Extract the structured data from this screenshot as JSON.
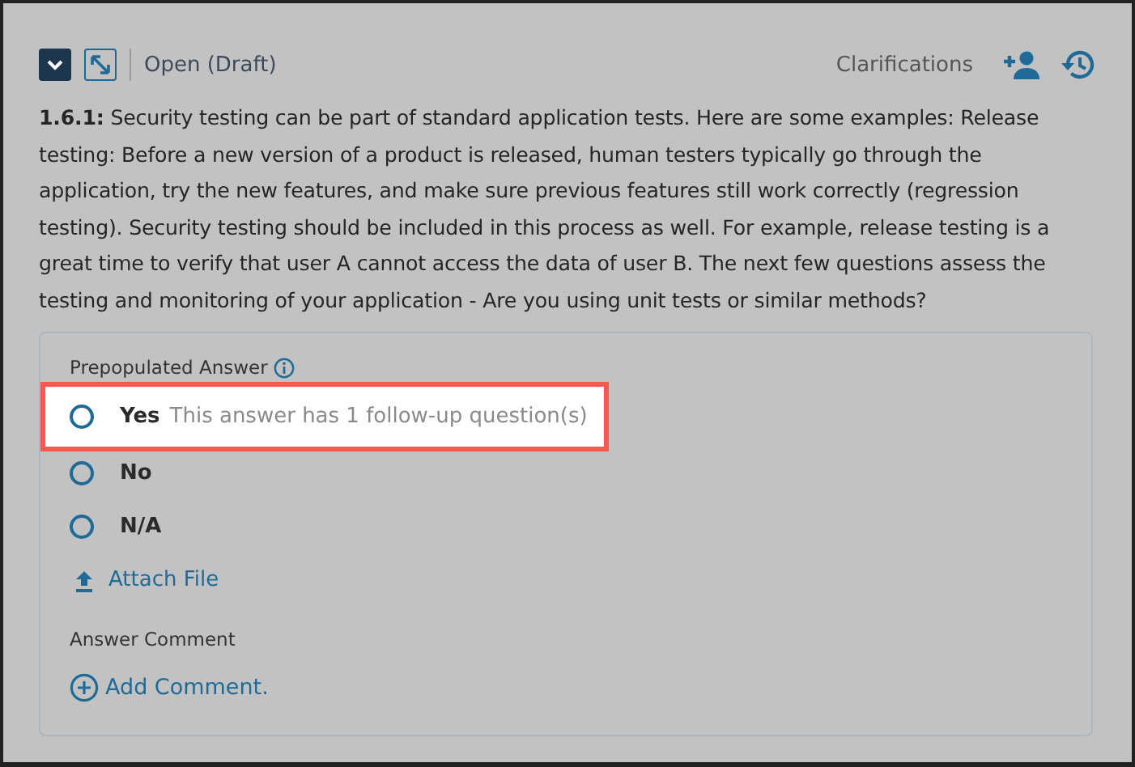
{
  "header": {
    "status": "Open (Draft)",
    "clarifications_label": "Clarifications"
  },
  "question": {
    "number": "1.6.1:",
    "text": "Security testing can be part of standard application tests. Here are some examples: Release testing: Before a new version of a product is released, human testers typically go through the application, try the new features, and make sure previous features still work correctly (regression testing). Security testing should be included in this process as well. For example, release testing is a great time to verify that user A cannot access the data of user B. The next few questions assess the testing and monitoring of your application - Are you using unit tests or similar methods?"
  },
  "answer": {
    "label": "Prepopulated Answer",
    "options": [
      {
        "label": "Yes",
        "selected": false,
        "highlighted": true,
        "note": "This answer has 1 follow-up question(s)"
      },
      {
        "label": "No",
        "selected": false,
        "highlighted": false
      },
      {
        "label": "N/A",
        "selected": false,
        "highlighted": false
      }
    ],
    "attach_label": "Attach File",
    "comment_label": "Answer Comment",
    "add_comment_label": "Add Comment."
  }
}
